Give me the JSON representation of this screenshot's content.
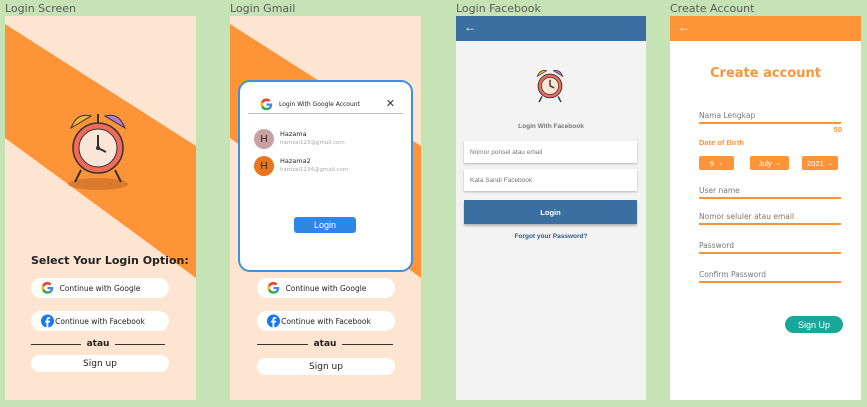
{
  "frames": {
    "login_screen": {
      "title": "Login Screen",
      "option_title": "Select Your Login Option:",
      "google_label": "Continue with Google",
      "facebook_label": "Continue with Facebook",
      "divider_text": "atau",
      "signup_label": "Sign up"
    },
    "login_gmail": {
      "title": "Login Gmail",
      "dialog_title": "Login With Google Account",
      "close_symbol": "✕",
      "accounts": [
        {
          "initial": "H",
          "name": "Hazama",
          "email": "hamzai123@gmail.com",
          "avatar_color": "#c9a1a1"
        },
        {
          "initial": "H",
          "name": "Hazama2",
          "email": "hamzai1234@gmail.com",
          "avatar_color": "#e8761c"
        }
      ],
      "login_label": "Login",
      "google_label": "Continue with Google",
      "facebook_label": "Continue with Facebook",
      "divider_text": "atau",
      "signup_label": "Sign up"
    },
    "login_facebook": {
      "title": "Login Facebook",
      "back_symbol": "←",
      "heading": "Login With Facebook",
      "phone_placeholder": "Nomor ponsel atau email",
      "password_placeholder": "Kata Sandi Facebook",
      "login_label": "Login",
      "forgot_label": "Forgot your Password?"
    },
    "create_account": {
      "title": "Create Account",
      "back_symbol": "←",
      "heading": "Create account",
      "full_name_placeholder": "Nama Lengkap",
      "char_count": "50",
      "dob_label": "Date of Birth",
      "day": "9",
      "month": "July",
      "year": "2021",
      "chevron": "⌄",
      "username_placeholder": "User name",
      "phone_placeholder": "Nomor seluler atau email",
      "password_placeholder": "Password",
      "confirm_placeholder": "Confirm Password",
      "signup_label": "Sign Up"
    }
  },
  "colors": {
    "canvas": "#c5e3b5",
    "peach": "#fde5d2",
    "orange": "#fd9438",
    "facebook_blue": "#3b6fa1",
    "google_blue": "#2d86e8",
    "teal": "#1aa69a"
  },
  "icons": [
    "alarm-clock-icon",
    "google-icon",
    "facebook-icon",
    "back-arrow-icon",
    "close-icon",
    "chevron-down-icon"
  ]
}
